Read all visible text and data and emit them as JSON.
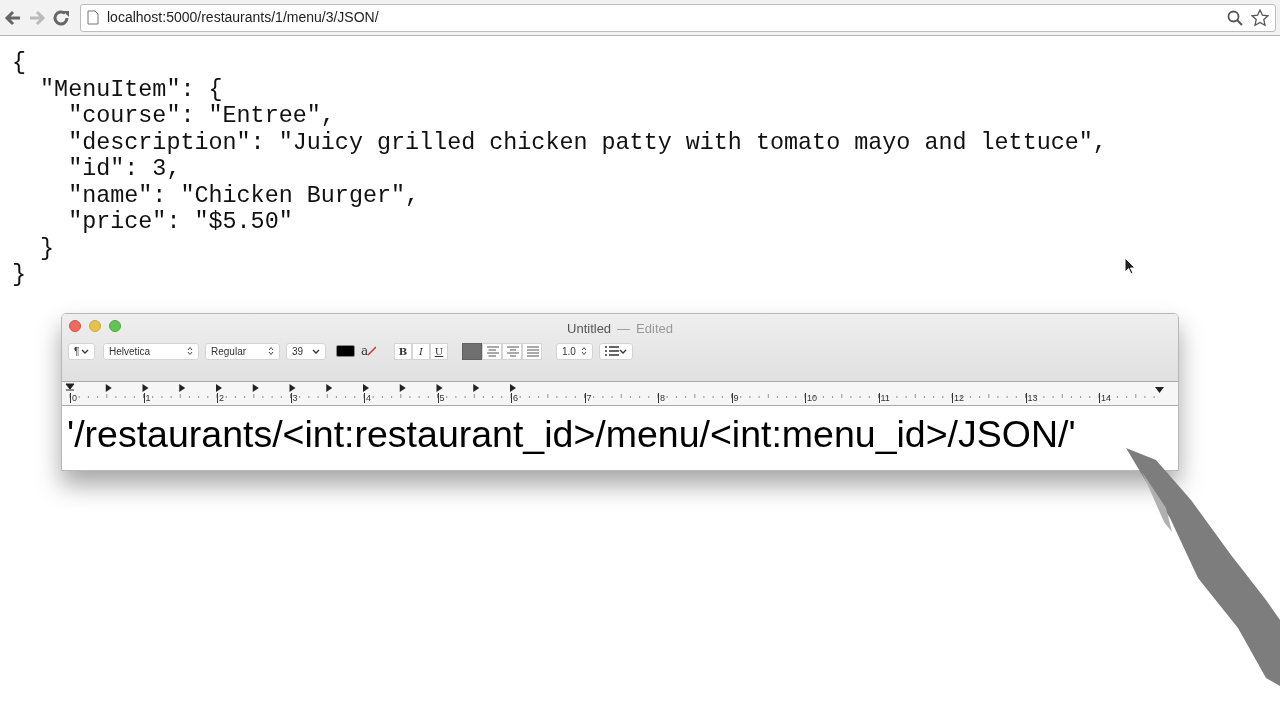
{
  "browser": {
    "url": "localhost:5000/restaurants/1/menu/3/JSON/"
  },
  "page": {
    "lines": [
      "{",
      "  \"MenuItem\": {",
      "    \"course\": \"Entree\",",
      "    \"description\": \"Juicy grilled chicken patty with tomato mayo and lettuce\",",
      "    \"id\": 3,",
      "    \"name\": \"Chicken Burger\",",
      "    \"price\": \"$5.50\"",
      "  }",
      "}"
    ]
  },
  "editor": {
    "title": "Untitled",
    "separator": "—",
    "status": "Edited",
    "toolbar": {
      "paragraph": "¶",
      "font": "Helvetica",
      "style": "Regular",
      "size": "39",
      "strike": "a",
      "format_buttons": [
        "B",
        "I",
        "U"
      ],
      "alignments": [
        {
          "kind": "left",
          "selected": true
        },
        {
          "kind": "center",
          "selected": false
        },
        {
          "kind": "right",
          "selected": false
        },
        {
          "kind": "justify",
          "selected": false
        }
      ],
      "spacing": "1.0"
    },
    "ruler": [
      "0",
      "1",
      "2",
      "3",
      "4",
      "5",
      "6",
      "7",
      "8",
      "9",
      "10",
      "11",
      "12",
      "13",
      "14"
    ],
    "text": "'/restaurants/<int:restaurant_id>/menu/<int:menu_id>/JSON/'"
  }
}
